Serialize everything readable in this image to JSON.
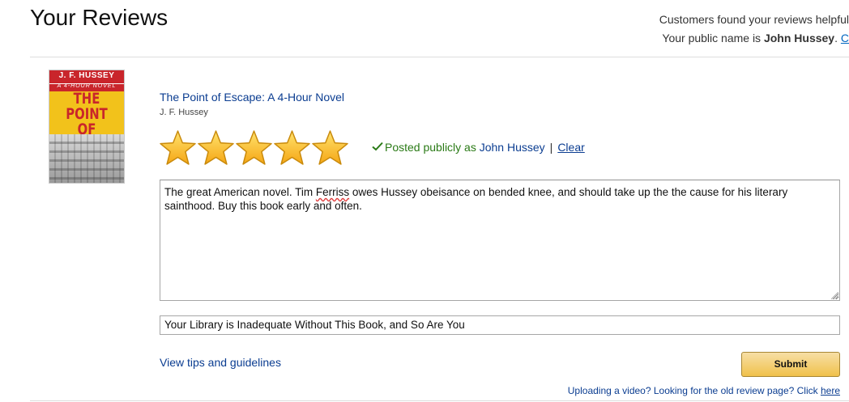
{
  "header": {
    "title": "Your Reviews",
    "helpful_text": "Customers found your reviews helpful",
    "public_name_prefix": "Your public name is ",
    "public_name": "John Hussey",
    "public_name_suffix": ".",
    "change_link": "C"
  },
  "book": {
    "cover": {
      "author": "J. F. HUSSEY",
      "subtitle": "A 4-HOUR NOVEL",
      "title_line1": "THE POINT",
      "title_line2": "OF ESCAPE"
    },
    "title": "The Point of Escape: A 4-Hour Novel",
    "author": "J. F. Hussey"
  },
  "rating": {
    "value": 5,
    "max": 5,
    "star_color": "#f5a614"
  },
  "posting": {
    "status_prefix": "Posted publicly as ",
    "name": "John Hussey",
    "separator": "|",
    "clear_label": "Clear",
    "status_color": "#2a7a16"
  },
  "review": {
    "body_part1": "The great American novel.  Tim ",
    "body_misspelled": "Ferriss",
    "body_part2": " owes Hussey obeisance on bended knee, and should take up the the cause for his literary sainthood.  Buy this book early and often.",
    "headline": "Your Library is Inadequate Without This Book, and So Are You"
  },
  "actions": {
    "tips_label": "View tips and guidelines",
    "submit_label": "Submit",
    "footer_text": "Uploading a video? Looking for the old review page? Click ",
    "footer_link": "here"
  }
}
